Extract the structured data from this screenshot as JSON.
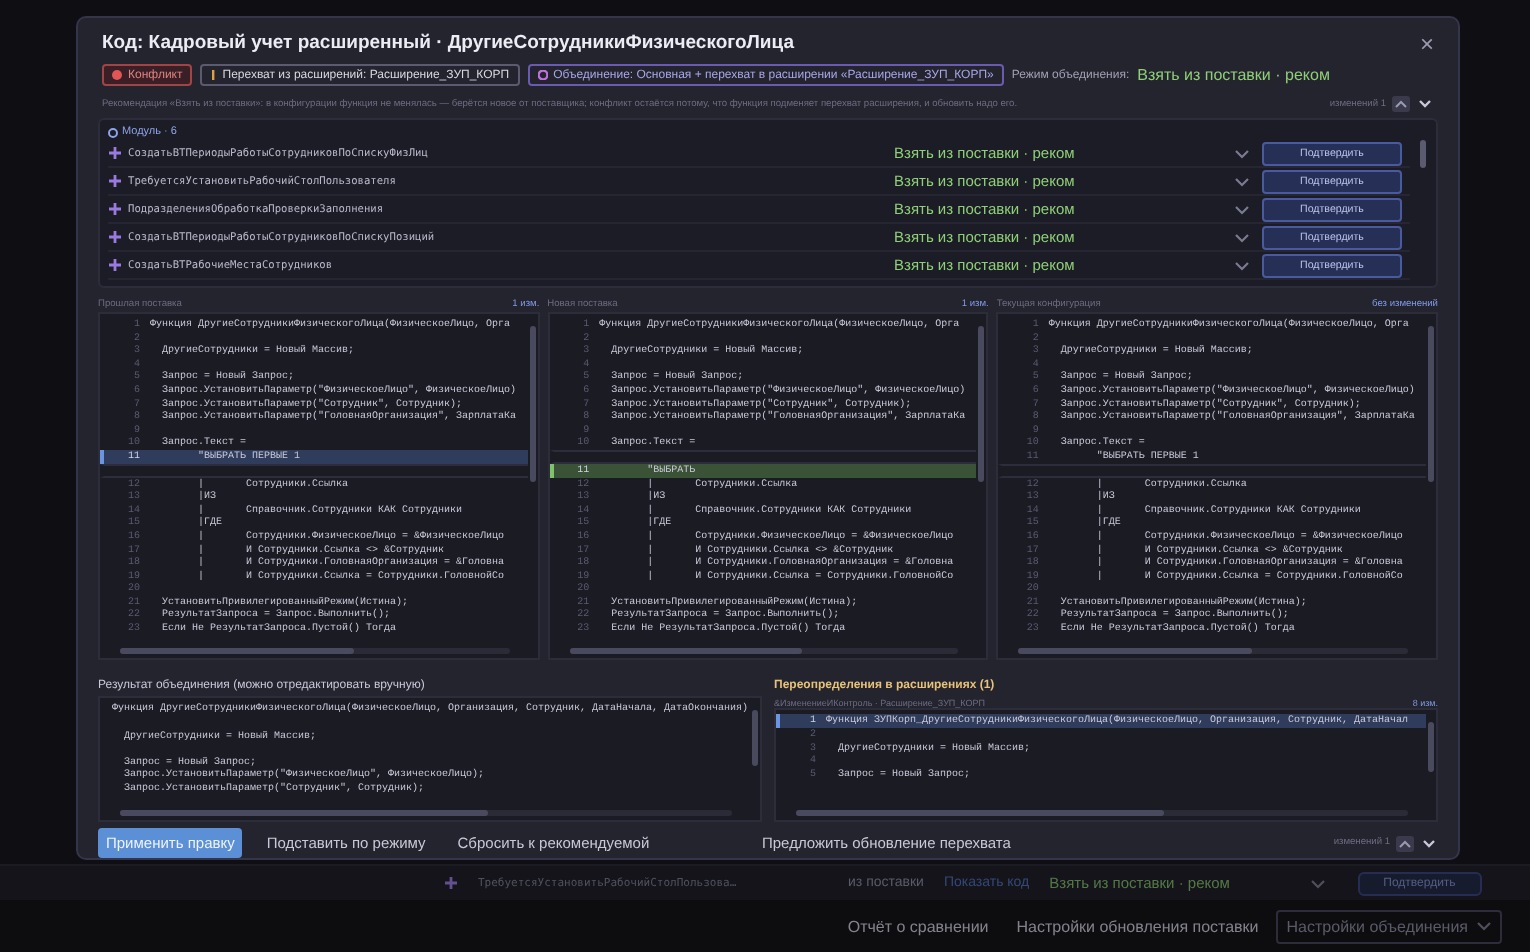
{
  "background": {
    "row": {
      "name": "ТребуетсяУстановитьРабочийСтолПользова…",
      "source": "из поставки",
      "link": "Показать код",
      "mode": "Взять из поставки · реком",
      "button": "Подтвердить"
    },
    "footer_buttons": [
      {
        "label": "Отчёт о сравнении",
        "kind": "plain"
      },
      {
        "label": "Настройки обновления поставки",
        "kind": "plain"
      },
      {
        "label": "Настройки объединения",
        "kind": "dropdown"
      }
    ]
  },
  "dialog": {
    "title": "Код: Кадровый учет расширенный · ДругиеСотрудникиФизическогоЛица",
    "close": "×",
    "tags": [
      {
        "kind": "conflict",
        "label": "Конфликт"
      },
      {
        "kind": "intercept",
        "label": "Перехват из расширений: Расширение_ЗУП_КОРП"
      },
      {
        "kind": "merge",
        "label": "Объединение: Основная + перехват в расширении «Расширение_ЗУП_КОРП»"
      }
    ],
    "merge_mode": {
      "label": "Режим объединения:",
      "value": "Взять из поставки · реком"
    },
    "recommendation": "Рекомендация «Взять из поставки»: в конфигурации функция не менялась — берётся новое от поставщика; конфликт остаётся потому, что функция подменяет перехват расширения, и обновить надо его.",
    "change_counter": "изменений 1",
    "modules": {
      "title": "Модуль · 6",
      "items": [
        {
          "name": "СоздатьВТПериодыРаботыСотрудниковПоСпискуФизЛиц",
          "mode": "Взять из поставки · реком",
          "button": "Подтвердить"
        },
        {
          "name": "ТребуетсяУстановитьРабочийСтолПользователя",
          "mode": "Взять из поставки · реком",
          "button": "Подтвердить"
        },
        {
          "name": "ПодразделенияОбработкаПроверкиЗаполнения",
          "mode": "Взять из поставки · реком",
          "button": "Подтвердить"
        },
        {
          "name": "СоздатьВТПериодыРаботыСотрудниковПоСпискуПозиций",
          "mode": "Взять из поставки · реком",
          "button": "Подтвердить"
        },
        {
          "name": "СоздатьВТРабочиеМестаСотрудников",
          "mode": "Взять из поставки · реком",
          "button": "Подтвердить"
        }
      ]
    },
    "panels": [
      {
        "title": "Прошлая поставка",
        "count": "1 изм.",
        "lines": [
          {
            "num": "1",
            "code": "Функция ДругиеСотрудникиФизическогоЛица(ФизическоеЛицо, Орга",
            "kind": "plain"
          },
          {
            "num": "2",
            "kind": "plain"
          },
          {
            "num": "3",
            "code": "  ДругиеСотрудники = Новый Массив;",
            "kind": "plain"
          },
          {
            "num": "4",
            "kind": "plain"
          },
          {
            "num": "5",
            "code": "  Запрос = Новый Запрос;",
            "kind": "plain"
          },
          {
            "num": "6",
            "code": "  Запрос.УстановитьПараметр(\"ФизическоеЛицо\", ФизическоеЛицо)",
            "kind": "plain"
          },
          {
            "num": "7",
            "code": "  Запрос.УстановитьПараметр(\"Сотрудник\", Сотрудник);",
            "kind": "plain"
          },
          {
            "num": "8",
            "code": "  Запрос.УстановитьПараметр(\"ГоловнаяОрганизация\", ЗарплатаКа",
            "kind": "plain"
          },
          {
            "num": "9",
            "kind": "plain"
          },
          {
            "num": "10",
            "code": "  Запрос.Текст =",
            "kind": "plain"
          },
          {
            "num": "11",
            "code": "        \"ВЫБРАТЬ ПЕРВЫЕ 1",
            "kind": "changed"
          },
          {
            "kind": "gap"
          },
          {
            "num": "12",
            "code": "        |       Сотрудники.Ссылка",
            "kind": "plain"
          },
          {
            "num": "13",
            "code": "        |ИЗ",
            "kind": "plain"
          },
          {
            "num": "14",
            "code": "        |       Справочник.Сотрудники КАК Сотрудники",
            "kind": "plain"
          },
          {
            "num": "15",
            "code": "        |ГДЕ",
            "kind": "plain"
          },
          {
            "num": "16",
            "code": "        |       Сотрудники.ФизическоеЛицо = &ФизическоеЛицо",
            "kind": "plain"
          },
          {
            "num": "17",
            "code": "        |       И Сотрудники.Ссылка <> &Сотрудник",
            "kind": "plain"
          },
          {
            "num": "18",
            "code": "        |       И Сотрудники.ГоловнаяОрганизация = &Головна",
            "kind": "plain"
          },
          {
            "num": "19",
            "code": "        |       И Сотрудники.Ссылка = Сотрудники.ГоловнойСо",
            "kind": "plain"
          },
          {
            "num": "20",
            "kind": "plain"
          },
          {
            "num": "21",
            "code": "  УстановитьПривилегированныйРежим(Истина);",
            "kind": "plain"
          },
          {
            "num": "22",
            "code": "  РезультатЗапроса = Запрос.Выполнить();",
            "kind": "plain"
          },
          {
            "num": "23",
            "code": "  Если Не РезультатЗапроса.Пустой() Тогда",
            "kind": "plain"
          }
        ]
      },
      {
        "title": "Новая поставка",
        "count": "1 изм.",
        "lines": [
          {
            "num": "1",
            "code": "Функция ДругиеСотрудникиФизическогоЛица(ФизическоеЛицо, Орга",
            "kind": "plain"
          },
          {
            "num": "2",
            "kind": "plain"
          },
          {
            "num": "3",
            "code": "  ДругиеСотрудники = Новый Массив;",
            "kind": "plain"
          },
          {
            "num": "4",
            "kind": "plain"
          },
          {
            "num": "5",
            "code": "  Запрос = Новый Запрос;",
            "kind": "plain"
          },
          {
            "num": "6",
            "code": "  Запрос.УстановитьПараметр(\"ФизическоеЛицо\", ФизическоеЛицо)",
            "kind": "plain"
          },
          {
            "num": "7",
            "code": "  Запрос.УстановитьПараметр(\"Сотрудник\", Сотрудник);",
            "kind": "plain"
          },
          {
            "num": "8",
            "code": "  Запрос.УстановитьПараметр(\"ГоловнаяОрганизация\", ЗарплатаКа",
            "kind": "plain"
          },
          {
            "num": "9",
            "kind": "plain"
          },
          {
            "num": "10",
            "code": "  Запрос.Текст =",
            "kind": "plain"
          },
          {
            "kind": "gap"
          },
          {
            "num": "11",
            "code": "        \"ВЫБРАТЬ",
            "kind": "added"
          },
          {
            "num": "12",
            "code": "        |       Сотрудники.Ссылка",
            "kind": "plain"
          },
          {
            "num": "13",
            "code": "        |ИЗ",
            "kind": "plain"
          },
          {
            "num": "14",
            "code": "        |       Справочник.Сотрудники КАК Сотрудники",
            "kind": "plain"
          },
          {
            "num": "15",
            "code": "        |ГДЕ",
            "kind": "plain"
          },
          {
            "num": "16",
            "code": "        |       Сотрудники.ФизическоеЛицо = &ФизическоеЛицо",
            "kind": "plain"
          },
          {
            "num": "17",
            "code": "        |       И Сотрудники.Ссылка <> &Сотрудник",
            "kind": "plain"
          },
          {
            "num": "18",
            "code": "        |       И Сотрудники.ГоловнаяОрганизация = &Головна",
            "kind": "plain"
          },
          {
            "num": "19",
            "code": "        |       И Сотрудники.Ссылка = Сотрудники.ГоловнойСо",
            "kind": "plain"
          },
          {
            "num": "20",
            "kind": "plain"
          },
          {
            "num": "21",
            "code": "  УстановитьПривилегированныйРежим(Истина);",
            "kind": "plain"
          },
          {
            "num": "22",
            "code": "  РезультатЗапроса = Запрос.Выполнить();",
            "kind": "plain"
          },
          {
            "num": "23",
            "code": "  Если Не РезультатЗапроса.Пустой() Тогда",
            "kind": "plain"
          }
        ]
      },
      {
        "title": "Текущая конфигурация",
        "count": "без изменений",
        "lines": [
          {
            "num": "1",
            "code": "Функция ДругиеСотрудникиФизическогоЛица(ФизическоеЛицо, Орга",
            "kind": "plain"
          },
          {
            "num": "2",
            "kind": "plain"
          },
          {
            "num": "3",
            "code": "  ДругиеСотрудники = Новый Массив;",
            "kind": "plain"
          },
          {
            "num": "4",
            "kind": "plain"
          },
          {
            "num": "5",
            "code": "  Запрос = Новый Запрос;",
            "kind": "plain"
          },
          {
            "num": "6",
            "code": "  Запрос.УстановитьПараметр(\"ФизическоеЛицо\", ФизическоеЛицо)",
            "kind": "plain"
          },
          {
            "num": "7",
            "code": "  Запрос.УстановитьПараметр(\"Сотрудник\", Сотрудник);",
            "kind": "plain"
          },
          {
            "num": "8",
            "code": "  Запрос.УстановитьПараметр(\"ГоловнаяОрганизация\", ЗарплатаКа",
            "kind": "plain"
          },
          {
            "num": "9",
            "kind": "plain"
          },
          {
            "num": "10",
            "code": "  Запрос.Текст =",
            "kind": "plain"
          },
          {
            "num": "11",
            "code": "        \"ВЫБРАТЬ ПЕРВЫЕ 1",
            "kind": "plain"
          },
          {
            "kind": "gap"
          },
          {
            "num": "12",
            "code": "        |       Сотрудники.Ссылка",
            "kind": "plain"
          },
          {
            "num": "13",
            "code": "        |ИЗ",
            "kind": "plain"
          },
          {
            "num": "14",
            "code": "        |       Справочник.Сотрудники КАК Сотрудники",
            "kind": "plain"
          },
          {
            "num": "15",
            "code": "        |ГДЕ",
            "kind": "plain"
          },
          {
            "num": "16",
            "code": "        |       Сотрудники.ФизическоеЛицо = &ФизическоеЛицо",
            "kind": "plain"
          },
          {
            "num": "17",
            "code": "        |       И Сотрудники.Ссылка <> &Сотрудник",
            "kind": "plain"
          },
          {
            "num": "18",
            "code": "        |       И Сотрудники.ГоловнаяОрганизация = &Головна",
            "kind": "plain"
          },
          {
            "num": "19",
            "code": "        |       И Сотрудники.Ссылка = Сотрудники.ГоловнойСо",
            "kind": "plain"
          },
          {
            "num": "20",
            "kind": "plain"
          },
          {
            "num": "21",
            "code": "  УстановитьПривилегированныйРежим(Истина);",
            "kind": "plain"
          },
          {
            "num": "22",
            "code": "  РезультатЗапроса = Запрос.Выполнить();",
            "kind": "plain"
          },
          {
            "num": "23",
            "code": "  Если Не РезультатЗапроса.Пустой() Тогда",
            "kind": "plain"
          }
        ]
      }
    ],
    "result": {
      "title": "Результат объединения (можно отредактировать вручную)",
      "lines": [
        {
          "code": "Функция ДругиеСотрудникиФизическогоЛица(ФизическоеЛицо, Организация, Сотрудник, ДатаНачала, ДатаОкончания)",
          "kind": "plain"
        },
        {
          "kind": "plain"
        },
        {
          "code": "  ДругиеСотрудники = Новый Массив;",
          "kind": "plain"
        },
        {
          "kind": "plain"
        },
        {
          "code": "  Запрос = Новый Запрос;",
          "kind": "plain"
        },
        {
          "code": "  Запрос.УстановитьПараметр(\"ФизическоеЛицо\", ФизическоеЛицо);",
          "kind": "plain"
        },
        {
          "code": "  Запрос.УстановитьПараметр(\"Сотрудник\", Сотрудник);",
          "kind": "plain"
        }
      ]
    },
    "overrides": {
      "title": "Переопределения в расширениях (1)",
      "subtitle": "&ИзменениеИКонтроль · Расширение_ЗУП_КОРП",
      "count": "8 изм.",
      "lines": [
        {
          "num": "1",
          "code": "Функция ЗУПКорп_ДругиеСотрудникиФизическогоЛица(ФизическоеЛицо, Организация, Сотрудник, ДатаНачал",
          "kind": "changed"
        },
        {
          "num": "2",
          "kind": "plain"
        },
        {
          "num": "3",
          "code": "  ДругиеСотрудники = Новый Массив;",
          "kind": "plain"
        },
        {
          "num": "4",
          "kind": "plain"
        },
        {
          "num": "5",
          "code": "  Запрос = Новый Запрос;",
          "kind": "plain"
        }
      ]
    },
    "buttons": [
      {
        "label": "Применить правку",
        "kind": "primary"
      },
      {
        "label": "Подставить по режиму",
        "kind": "plain"
      },
      {
        "label": "Сбросить к рекомендуемой",
        "kind": "plain"
      }
    ],
    "suggest": "Предложить обновление перехвата",
    "change_counter_bottom": "изменений 1"
  }
}
